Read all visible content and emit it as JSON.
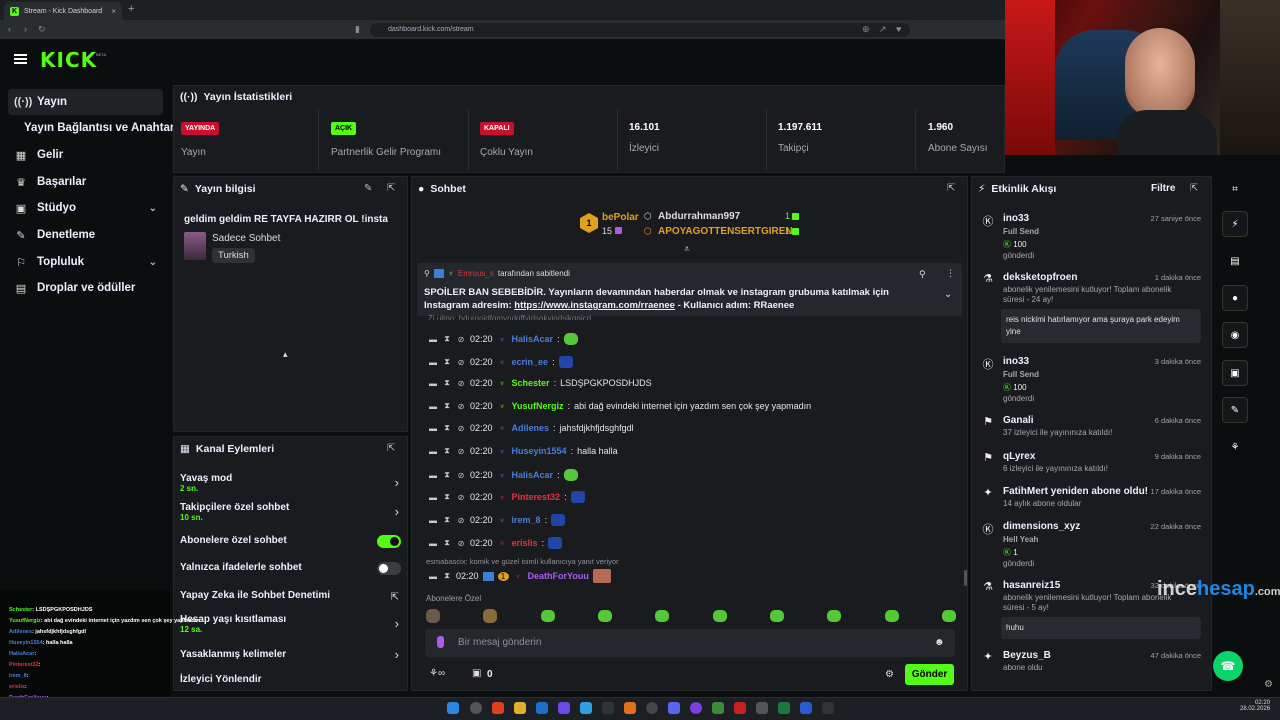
{
  "browser": {
    "tab_title": "Stream - Kick Dashboard",
    "tab_close": "×",
    "new_tab": "+",
    "url": "dashboard.kick.com/stream"
  },
  "brand": {
    "logo": "KICK",
    "beta": "BETA"
  },
  "sidebar": {
    "items": [
      {
        "label": "Yayın",
        "icon": "broadcast-icon"
      },
      {
        "label": "Yayın Bağlantısı ve Anahtarı"
      },
      {
        "label": "Gelir",
        "icon": "revenue-icon"
      },
      {
        "label": "Başarılar",
        "icon": "trophy-icon"
      },
      {
        "label": "Stüdyo",
        "icon": "studio-icon"
      },
      {
        "label": "Denetleme",
        "icon": "wrench-icon"
      },
      {
        "label": "Topluluk",
        "icon": "community-icon"
      },
      {
        "label": "Droplar ve ödüller",
        "icon": "gift-icon"
      }
    ]
  },
  "stats": {
    "title": "Yayın İstatistikleri",
    "live_badge": "YAYINDA",
    "live_label": "Yayın",
    "partner_badge": "AÇIK",
    "partner_label": "Partnerlik Gelir Programı",
    "multi_badge": "KAPALI",
    "multi_label": "Çoklu Yayın",
    "viewers_value": "16.101",
    "viewers_label": "İzleyici",
    "followers_value": "1.197.611",
    "followers_label": "Takipçi",
    "subs_value": "1.960",
    "subs_label": "Abone Sayısı"
  },
  "stream_info": {
    "title": "Yayın bilgisi",
    "stream_title": "geldim geldim RE TAYFA HAZIRR OL !insta",
    "category": "Sadece Sohbet",
    "tag": "Turkish"
  },
  "channel_actions": {
    "title": "Kanal Eylemleri",
    "slow_mode": "Yavaş mod",
    "slow_mode_value": "2 sn.",
    "followers_chat": "Takipçilere özel sohbet",
    "followers_chat_value": "10 sn.",
    "subs_chat": "Abonelere özel sohbet",
    "emote_chat": "Yalnızca ifadelerle sohbet",
    "ai_mod": "Yapay Zeka ile Sohbet Denetimi",
    "account_age": "Hesap yaşı kısıtlaması",
    "account_age_value": "12 sa.",
    "banned_words": "Yasaklanmış kelimeler",
    "viewer_redirect": "İzleyici Yönlendir"
  },
  "chat": {
    "title": "Sohbet",
    "top1_name": "bePolar",
    "top1_count": "15",
    "top1_rank": "1",
    "top2_name": "Abdurrahman997",
    "top2_count": "1",
    "top3_name": "APOYAGOTTENSERTGIREN",
    "top3_count": "1",
    "pinned_by_user": "Emrous_s",
    "pinned_by_text": "tarafından sabitlendi",
    "pinned_text": "SPOİLER BAN SEBEBİDİR. Yayınların devamından haberdar olmak ve instagram grubuma katılmak için Instagram adresim:",
    "pinned_link": "https://www.instagram.com/rraenee",
    "pinned_tail": "- Kullanıcı adım: RRaenee",
    "partial_msg": "Zi.ulmo: hdurgojdfgmyndgffyjdsgkyjgdsjkgnjcd",
    "messages": [
      {
        "time": "02:20",
        "user": "HalisAcar",
        "color": "#4a7fd9",
        "text": "",
        "emote": "eg"
      },
      {
        "time": "02:20",
        "user": "ecrin_ee",
        "color": "#4a7fd9",
        "text": "",
        "emote": "eb"
      },
      {
        "time": "02:20",
        "user": "Schester",
        "color": "#53fc18",
        "text": "LSDŞPGKPOSDHJDS",
        "emote": ""
      },
      {
        "time": "02:20",
        "user": "YusufNergiz",
        "color": "#53fc18",
        "text": "abi dağ evindeki internet için yazdım sen çok şey yapmadın",
        "emote": ""
      },
      {
        "time": "02:20",
        "user": "Adilenes",
        "color": "#4a7fd9",
        "text": "jahsfdjkhfjdsghfgdl",
        "emote": ""
      },
      {
        "time": "02:20",
        "user": "Huseyin1554",
        "color": "#4a7fd9",
        "text": "halla halla",
        "emote": ""
      },
      {
        "time": "02:20",
        "user": "HalisAcar",
        "color": "#4a7fd9",
        "text": "",
        "emote": "eg"
      },
      {
        "time": "02:20",
        "user": "Pinterest32",
        "color": "#e0343e",
        "text": "",
        "emote": "eb"
      },
      {
        "time": "02:20",
        "user": "irem_8",
        "color": "#4a7fd9",
        "text": "",
        "emote": "eb"
      },
      {
        "time": "02:20",
        "user": "erislis",
        "color": "#e0343e",
        "text": "",
        "emote": "eb"
      }
    ],
    "reply_hint": "esmabascix: komik ve güzel isimli kullanıcıya yanıt veriyor",
    "last_time": "02:20",
    "last_user": "DeathForYouu",
    "subs_emotes_label": "Abonelere Özel",
    "input_placeholder": "Bir mesaj gönderin",
    "points": "0",
    "send": "Gönder"
  },
  "activity": {
    "title": "Etkinlik Akışı",
    "filter": "Filtre",
    "items": [
      {
        "name": "ino33",
        "time": "27 saniye önce",
        "line1": "Full Send",
        "amount": "100",
        "line2": "gönderdi"
      },
      {
        "name": "deksketopfroen",
        "time": "1 dakika önce",
        "line1": "abonelik yenilemesini kutluyor! Toplam abonelik",
        "line2": "süresi - 24 ay!",
        "note": "reis nickimi hatırlamıyor ama şuraya park edeyim yine"
      },
      {
        "name": "ino33",
        "time": "3 dakika önce",
        "line1": "Full Send",
        "amount": "100",
        "line2": "gönderdi"
      },
      {
        "name": "Ganali",
        "time": "6 dakika önce",
        "line1": "37 izleyici ile yayınınıza katıldı!"
      },
      {
        "name": "qLyrex",
        "time": "9 dakika önce",
        "line1": "6 izleyici ile yayınınıza katıldı!"
      },
      {
        "name": "FatihMert yeniden abone oldu!",
        "time": "17 dakika önce",
        "line1": "14 aylık abone oldular"
      },
      {
        "name": "dimensions_xyz",
        "time": "22 dakika önce",
        "line1": "Hell Yeah",
        "amount": "1",
        "line2": "gönderdi"
      },
      {
        "name": "hasanreiz15",
        "time": "32 dakika önce",
        "line1": "abonelik yenilemesini kutluyor! Toplam abonelik",
        "line2": "süresi - 5 ay!",
        "note": "huhu"
      },
      {
        "name": "Beyzus_B",
        "time": "47 dakika önce",
        "line1": "abone oldu"
      }
    ]
  },
  "watermark": {
    "part1": "ince",
    "part2": "hesap",
    "part3": ".com"
  },
  "overlay_chat": [
    {
      "user": "Schester",
      "text": ": LSDŞPGKPOSDHJDS",
      "color": "#53fc18"
    },
    {
      "user": "YusufNergiz",
      "text": ": abi dağ evindeki internet için yazdım sen çok şey yapmadın",
      "color": "#53fc18"
    },
    {
      "user": "Adilenes",
      "text": ": jahsfdjkhfjdsghfgdl",
      "color": "#4a7fd9"
    },
    {
      "user": "Huseyin1554",
      "text": ": halla halla",
      "color": "#4a7fd9"
    },
    {
      "user": "HalisAcar",
      "text": ":",
      "color": "#4a7fd9"
    },
    {
      "user": "Pinterest32",
      "text": ":",
      "color": "#e0343e"
    },
    {
      "user": "irem_8",
      "text": ":",
      "color": "#4a7fd9"
    },
    {
      "user": "erislis",
      "text": ":",
      "color": "#e0343e"
    },
    {
      "user": "DeathForYouu",
      "text": ":",
      "color": "#b05af0"
    }
  ],
  "taskbar": {
    "time": "02:20",
    "date": "28.02.2026"
  }
}
